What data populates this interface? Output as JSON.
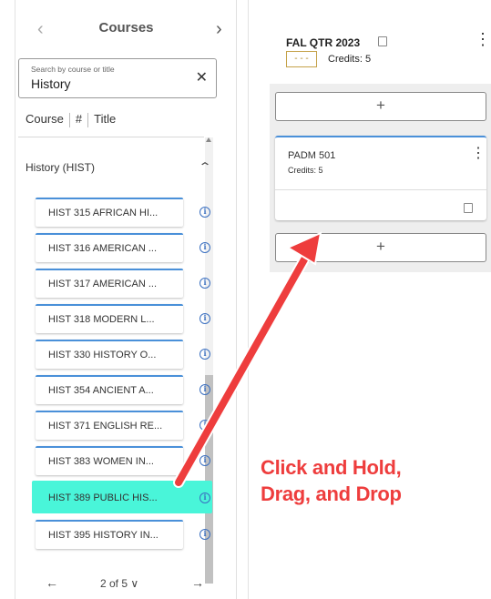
{
  "left_panel": {
    "title": "Courses",
    "prev_icon": "chevron-left",
    "next_icon": "chevron-right",
    "search": {
      "label": "Search by course or title",
      "value": "History",
      "clear_icon": "close"
    },
    "sort": {
      "course": "Course",
      "number": "#",
      "title": "Title"
    },
    "group": {
      "label": "History (HIST)",
      "expanded": true
    },
    "courses": [
      {
        "label": "HIST 315 AFRICAN HI..."
      },
      {
        "label": "HIST 316 AMERICAN ..."
      },
      {
        "label": "HIST 317 AMERICAN ..."
      },
      {
        "label": "HIST 318 MODERN L..."
      },
      {
        "label": "HIST 330 HISTORY O..."
      },
      {
        "label": "HIST 354 ANCIENT A..."
      },
      {
        "label": "HIST 371 ENGLISH RE..."
      },
      {
        "label": "HIST 383 WOMEN IN..."
      },
      {
        "label": "HIST 389 PUBLIC HIS...",
        "highlighted": true
      },
      {
        "label": "HIST 395 HISTORY IN..."
      }
    ],
    "pager": {
      "text": "2 of 5 ∨",
      "prev": "←",
      "next": "→"
    }
  },
  "term": {
    "title": "FAL QTR 2023",
    "dashes": "- - -",
    "credits": "Credits:  5",
    "add_label": "+",
    "course": {
      "title": "PADM 501",
      "credits": "Credits: 5"
    }
  },
  "annotation": {
    "line1": "Click and Hold,",
    "line2": "Drag, and Drop",
    "color": "#ee3d3d"
  },
  "colors": {
    "accent": "#4a90d9",
    "highlight": "#49f5d9",
    "arrow": "#ee3d3d"
  }
}
